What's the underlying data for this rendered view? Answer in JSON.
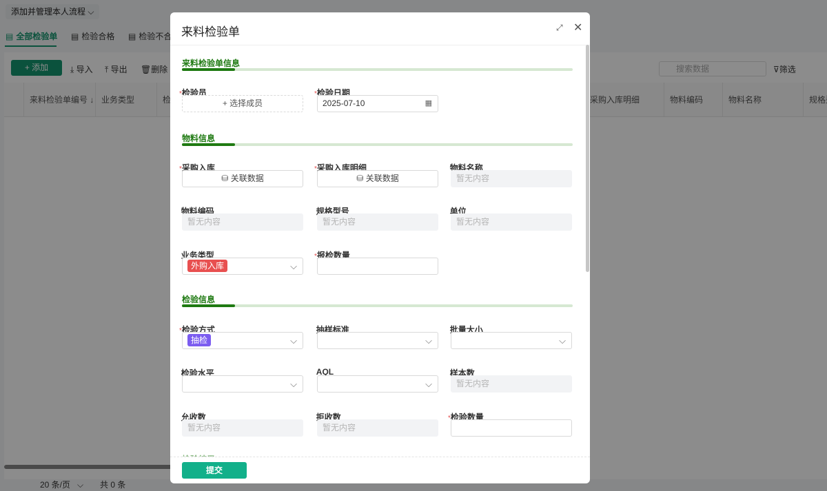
{
  "app": {
    "flow_button": "添加并管理本人流程",
    "tabs": [
      {
        "label": "全部检验单"
      },
      {
        "label": "检验合格"
      },
      {
        "label": "检验不合格"
      }
    ],
    "toolbar": {
      "add": "添加",
      "import": "导入",
      "export": "导出",
      "delete": "删除",
      "search_placeholder": "搜索数据",
      "filter": "筛选"
    },
    "columns": [
      "来料检验单编号",
      "业务类型",
      "检",
      "采购入库明细",
      "物料编码",
      "物料名称",
      "规格型号"
    ],
    "pagination": {
      "page_size": "20 条/页",
      "total": "共 0 条"
    }
  },
  "modal": {
    "title": "来料检验单",
    "sections": {
      "s1": "来料检验单信息",
      "s2": "物料信息",
      "s3": "检验信息",
      "s4": "检验结果"
    },
    "fields": {
      "inspector": {
        "label": "检验员",
        "value": "+ 选择成员"
      },
      "date": {
        "label": "检验日期",
        "value": "2025-07-10"
      },
      "purchase_in": {
        "label": "采购入库",
        "value": "关联数据"
      },
      "purchase_in_detail": {
        "label": "采购入库明细",
        "value": "关联数据"
      },
      "material_name": {
        "label": "物料名称",
        "value": "暂无内容"
      },
      "material_code": {
        "label": "物料编码",
        "value": "暂无内容"
      },
      "spec": {
        "label": "规格型号",
        "value": "暂无内容"
      },
      "unit": {
        "label": "单位",
        "value": "暂无内容"
      },
      "biz_type": {
        "label": "业务类型",
        "value": "外购入库"
      },
      "report_qty": {
        "label": "报检数量",
        "value": ""
      },
      "method": {
        "label": "检验方式",
        "value": "抽检"
      },
      "sampling_std": {
        "label": "抽样标准",
        "value": ""
      },
      "batch_size": {
        "label": "批量大小",
        "value": ""
      },
      "level": {
        "label": "检验水平",
        "value": ""
      },
      "aql": {
        "label": "AQL",
        "value": ""
      },
      "sample_count": {
        "label": "样本数",
        "value": "暂无内容"
      },
      "accept": {
        "label": "允收数",
        "value": "暂无内容"
      },
      "reject": {
        "label": "拒收数",
        "value": "暂无内容"
      },
      "inspect_qty": {
        "label": "检验数量",
        "value": ""
      }
    },
    "submit": "提交",
    "colors": {
      "accent": "#12b08a",
      "section": "#1f7a12",
      "tag_red": "#e85050",
      "tag_purple": "#7b5cf0"
    }
  }
}
